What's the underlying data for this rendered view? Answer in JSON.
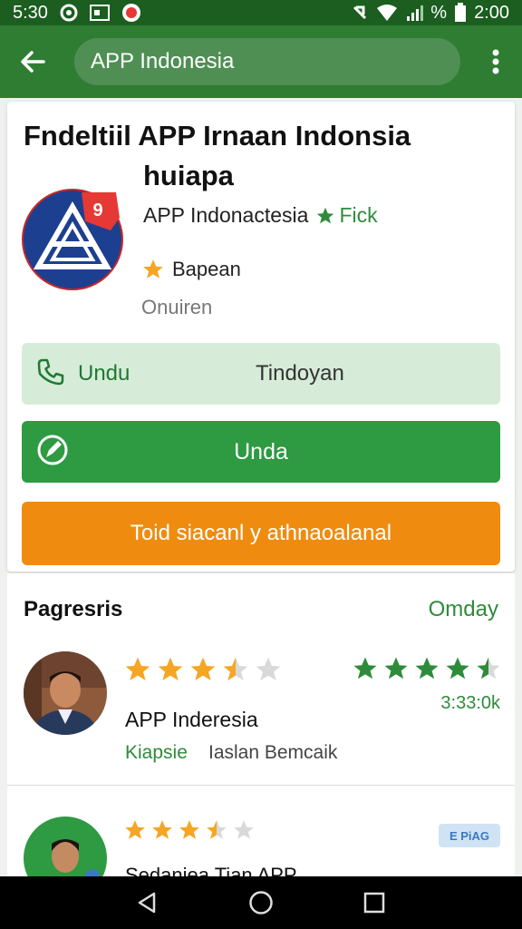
{
  "status_bar": {
    "time": "5:30",
    "clock": "2:00",
    "signal_text": "%",
    "icons": [
      "alarm-icon",
      "image-notification-icon",
      "app-notification-icon",
      "mute-icon",
      "wifi-icon",
      "signal-icon",
      "battery-icon"
    ]
  },
  "app_bar": {
    "search_value": "APP Indonesia",
    "back_icon": "arrow-left-icon",
    "menu_icon": "more-vert-icon"
  },
  "app": {
    "title_line1": "Fndeltiil APP Irnaan Indonsia",
    "title_line2": "huiapa",
    "developer": "APP Indonactesia",
    "badge": "Fick",
    "rating_label": "Bapean",
    "status": "Onuiren",
    "logo_badge": "9"
  },
  "actions": {
    "primary_light_label": "Undu",
    "primary_light_secondary": "Tindoyan",
    "primary_label": "Unda",
    "secondary_label": "Toid siacanl y athnaoalanal"
  },
  "reviews": {
    "heading": "Pagresris",
    "filter": "Omday",
    "items": [
      {
        "name": "APP Inderesia",
        "tag": "Kiapsie",
        "text": "Iaslan Bemcaik",
        "time": "3:33:0k",
        "stars_left": 3.5,
        "stars_right": 4.5
      },
      {
        "name": "Sedaniea Tian APP",
        "badge": "E PiAG",
        "stars_left": 3.5
      }
    ]
  },
  "nav": {
    "back": "nav-back-icon",
    "home": "nav-home-icon",
    "recents": "nav-recents-icon"
  },
  "colors": {
    "app_bar": "#2e7d32",
    "status_bar": "#1b5e20",
    "primary_green": "#2e9a41",
    "light_green": "#d6ecd9",
    "orange": "#ef8c0f",
    "star_gold": "#f5a623",
    "star_green": "#2e8b3a",
    "logo_blue": "#1d3f8f",
    "logo_red": "#e53935"
  }
}
